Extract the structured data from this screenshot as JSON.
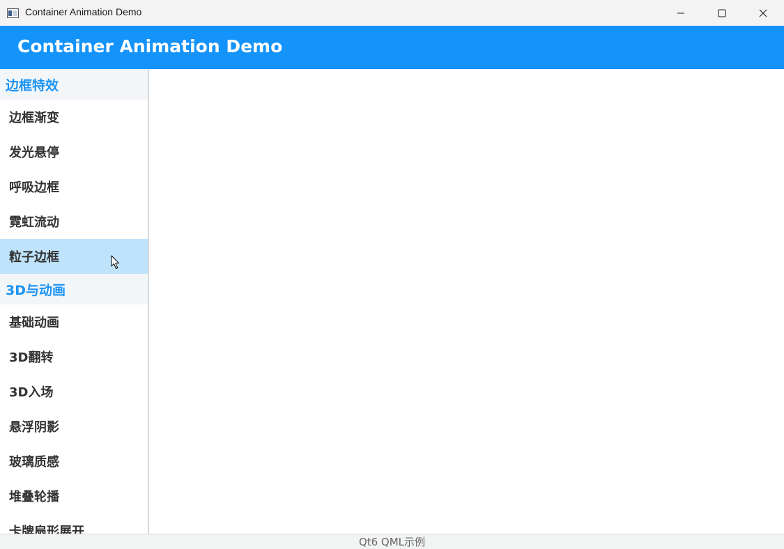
{
  "window": {
    "title": "Container Animation Demo"
  },
  "header": {
    "title": "Container Animation Demo"
  },
  "sidebar": {
    "sections": [
      {
        "title": "边框特效",
        "items": [
          {
            "label": "边框渐变",
            "selected": false
          },
          {
            "label": "发光悬停",
            "selected": false
          },
          {
            "label": "呼吸边框",
            "selected": false
          },
          {
            "label": "霓虹流动",
            "selected": false
          },
          {
            "label": "粒子边框",
            "selected": true
          }
        ]
      },
      {
        "title": "3D与动画",
        "items": [
          {
            "label": "基础动画",
            "selected": false
          },
          {
            "label": "3D翻转",
            "selected": false
          },
          {
            "label": "3D入场",
            "selected": false
          },
          {
            "label": "悬浮阴影",
            "selected": false
          },
          {
            "label": "玻璃质感",
            "selected": false
          },
          {
            "label": "堆叠轮播",
            "selected": false
          },
          {
            "label": "卡牌扇形展开",
            "selected": false
          }
        ]
      }
    ]
  },
  "statusbar": {
    "text": "Qt6 QML示例"
  },
  "colors": {
    "accent": "#1493fa",
    "section_text": "#1b93f5",
    "selected_bg": "#bee3fa",
    "section_bg": "#f2f6f9"
  },
  "icons": {
    "app": "app-window-icon",
    "minimize": "minimize-icon",
    "maximize": "maximize-icon",
    "close": "close-icon",
    "cursor": "mouse-cursor-icon"
  }
}
